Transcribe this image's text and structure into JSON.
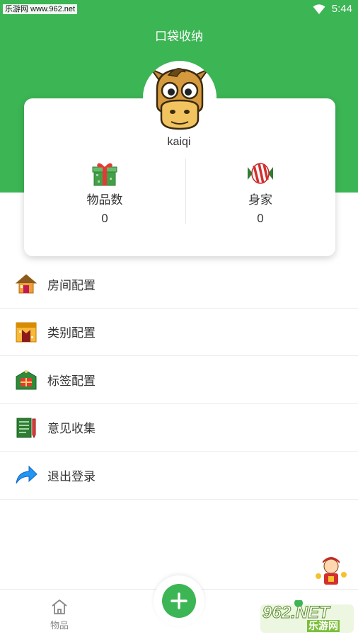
{
  "status_bar": {
    "watermark": "乐游网 www.962.net",
    "time": "5:44",
    "icons": [
      "wifi-icon"
    ]
  },
  "app_title": "口袋收纳",
  "profile": {
    "username": "kaiqi",
    "avatar_icon": "cartoon-horse-avatar",
    "stats": [
      {
        "icon": "gift-box-icon",
        "label": "物品数",
        "value": "0"
      },
      {
        "icon": "candy-icon",
        "label": "身家",
        "value": "0"
      }
    ]
  },
  "menu": [
    {
      "icon": "house-icon",
      "label": "房间配置"
    },
    {
      "icon": "category-icon",
      "label": "类别配置"
    },
    {
      "icon": "tag-icon",
      "label": "标签配置"
    },
    {
      "icon": "feedback-icon",
      "label": "意见收集"
    },
    {
      "icon": "logout-arrow-icon",
      "label": "退出登录"
    }
  ],
  "tab_bar": {
    "home_label": "物品",
    "add_icon": "plus-icon"
  },
  "corner_watermark": {
    "logo": "962.NET",
    "sub": "乐游网"
  },
  "colors": {
    "brand_green": "#3cb554",
    "text": "#333333",
    "muted": "#888888"
  }
}
